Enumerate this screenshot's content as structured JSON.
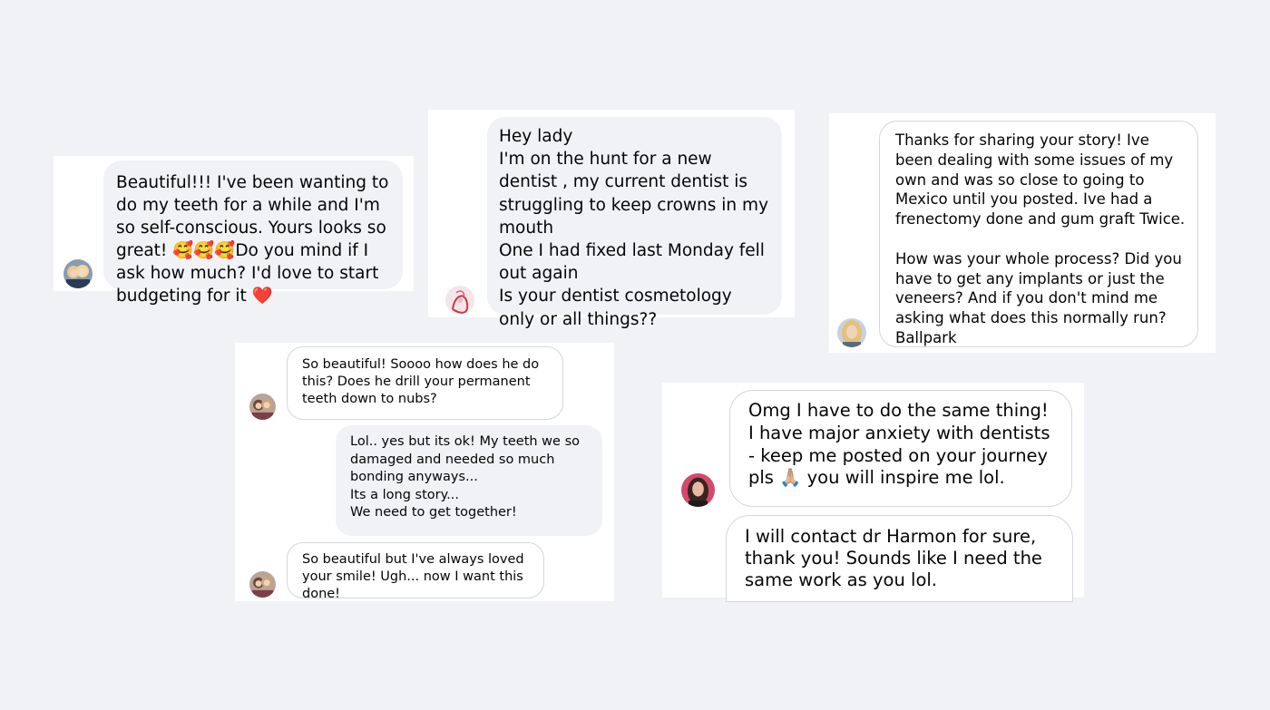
{
  "messages": {
    "msg1": {
      "text": "Beautiful!!! I've been wanting to do my teeth for a while and I'm so self-conscious. Yours looks so great! 🥰🥰🥰Do you mind if I ask how much? I'd love to start budgeting for it ❤️"
    },
    "msg2": {
      "text": "Hey lady\nI'm on the hunt for a new dentist , my current dentist is struggling to keep crowns in my mouth\nOne I had fixed last Monday fell out again\nIs your dentist cosmetology only or all things??"
    },
    "msg3": {
      "text": "Thanks for sharing your story!  Ive been dealing with some issues of my own and was so close to going to Mexico until you posted. Ive had a frenectomy done and gum graft Twice.\n\nHow was your whole process? Did you have to get any implants or just the veneers? And if you don't mind me asking what does this normally run? Ballpark"
    },
    "msg4a": {
      "text": "So beautiful! Soooo how does he do this? Does he drill your permanent teeth down to nubs?"
    },
    "msg4b": {
      "text": "Lol.. yes but its ok! My teeth we so damaged and needed so much bonding anyways...\nIts a long story...\nWe need to get together!"
    },
    "msg4c": {
      "text": "So beautiful but I've always loved your smile! Ugh... now I want this done!"
    },
    "msg5a": {
      "text": "Omg I have to do the same thing! I have major anxiety with dentists - keep me posted on your journey pls 🙏🏼 you will inspire me lol."
    },
    "msg5b": {
      "text": "I will contact dr Harmon for sure, thank you! Sounds like I need the same work as you lol."
    }
  },
  "avatars": {
    "a1": "avatar-blonde-couple-icon",
    "a2": "avatar-red-sketch-icon",
    "a3": "avatar-blonde-woman-icon",
    "a4": "avatar-couple-icon",
    "a5": "avatar-brunette-woman-icon"
  },
  "colors": {
    "page_background": "#f0f2f5",
    "bubble_gray": "#f0f2f5",
    "bubble_border": "#d4d6da",
    "text": "#050505",
    "heart": "#e0245e"
  }
}
